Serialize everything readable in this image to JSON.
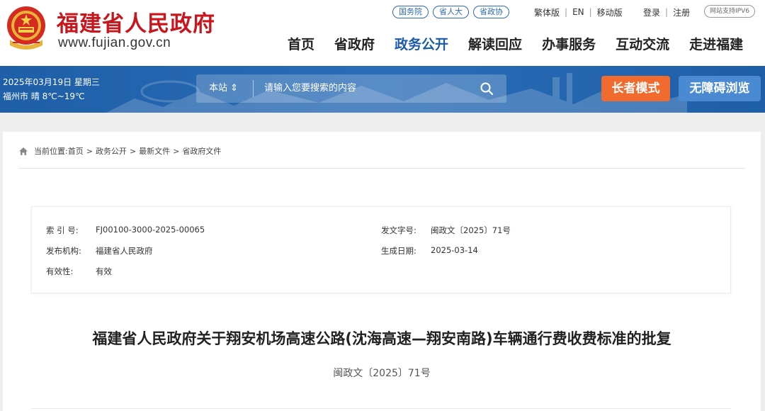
{
  "header": {
    "site_title": "福建省人民政府",
    "site_url": "www.fujian.gov.cn",
    "top_pills": [
      "国务院",
      "省人大",
      "省政协"
    ],
    "util_links": [
      "繁体版",
      "EN",
      "移动版"
    ],
    "account_links": [
      "登录",
      "注册"
    ],
    "ipv6_label": "网站支持IPV6",
    "nav": [
      "首页",
      "省政府",
      "务公开",
      "解读回应",
      "办事服务",
      "互动交流",
      "走进福建"
    ],
    "active_nav": "政务公开"
  },
  "band": {
    "date": "2025年03月19日 星期三",
    "weather": "福州市 晴 8℃~19℃",
    "search_scope": "本站 ⇕",
    "search_placeholder": "请输入您要搜索的内容",
    "elder_mode": "长者模式",
    "accessible": "无障碍浏览"
  },
  "breadcrumb": {
    "prefix": "当前位置:",
    "items": [
      "首页",
      "政务公开",
      "最新文件",
      "省政府文件"
    ]
  },
  "meta": {
    "index_label": "索 引 号:",
    "index_value": "FJ00100-3000-2025-00065",
    "docno_label": "发文字号:",
    "docno_value": "闽政文〔2025〕71号",
    "publisher_label": "发布机构:",
    "publisher_value": "福建省人民政府",
    "date_label": "生成日期:",
    "date_value": "2025-03-14",
    "validity_label": "有效性:",
    "validity_value": "有效"
  },
  "article": {
    "title": "福建省人民政府关于翔安机场高速公路(沈海高速—翔安南路)车辆通行费收费标准的批复",
    "doc_number": "闽政文〔2025〕71号"
  },
  "colors": {
    "brand_red": "#c8161d",
    "nav_active": "#1a5aa8",
    "band_blue": "#1e5fa8",
    "elder_orange": "#f06b2d",
    "access_blue": "#4a8ad2"
  }
}
